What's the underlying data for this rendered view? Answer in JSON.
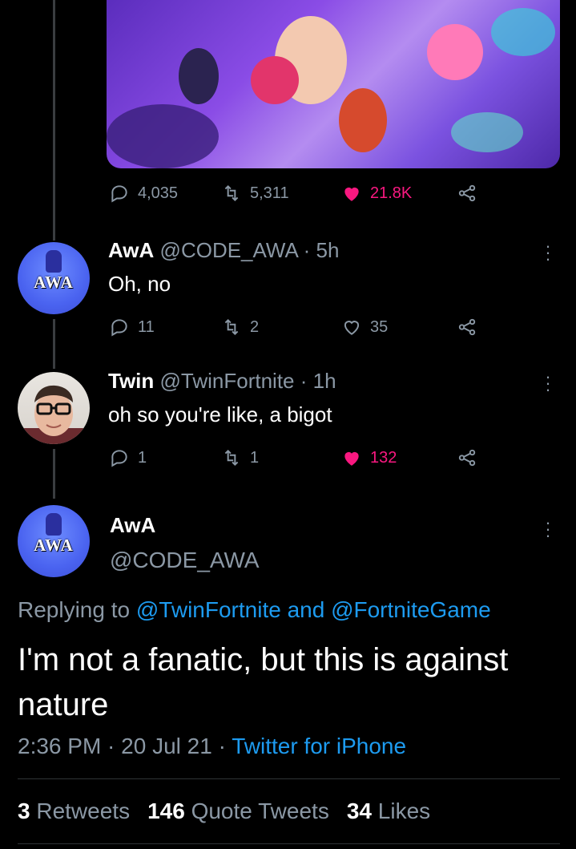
{
  "colors": {
    "background": "#000000",
    "muted": "#8b98a5",
    "link": "#1d9bf0",
    "like": "#f91880"
  },
  "top_tweet": {
    "stats": {
      "replies": "4,035",
      "retweets": "5,311",
      "likes": "21.8K"
    }
  },
  "reply1": {
    "name": "AwA",
    "handle_time": "@CODE_AWA · 5h",
    "text": "Oh, no",
    "avatar_text": "AWA",
    "stats": {
      "replies": "11",
      "retweets": "2",
      "likes": "35"
    }
  },
  "reply2": {
    "name": "Twin",
    "handle_time": "@TwinFortnite · 1h",
    "text": "oh so you're like, a bigot",
    "stats": {
      "replies": "1",
      "retweets": "1",
      "likes": "132"
    }
  },
  "main": {
    "name": "AwA",
    "handle": "@CODE_AWA",
    "avatar_text": "AWA",
    "replying_prefix": "Replying to",
    "reply_user1": "@TwinFortnite",
    "reply_and": "and",
    "reply_user2": "@FortniteGame",
    "text": "I'm not a fanatic, but this is against nature",
    "time": "2:36 PM · 20 Jul 21 ·",
    "client": "Twitter for iPhone",
    "stats": {
      "retweets_count": "3",
      "retweets_label": "Retweets",
      "quotes_count": "146",
      "quotes_label": "Quote Tweets",
      "likes_count": "34",
      "likes_label": "Likes"
    }
  }
}
